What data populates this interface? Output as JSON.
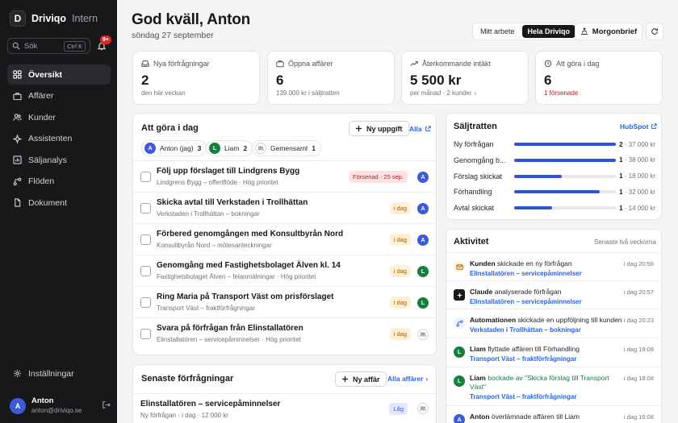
{
  "brand": {
    "name": "Driviqo",
    "sub": "Intern",
    "logo": "D"
  },
  "search": {
    "placeholder": "Sök",
    "shortcut": "Ctrl K"
  },
  "notifications": {
    "badge": "9+"
  },
  "nav": [
    {
      "label": "Översikt",
      "icon": "grid-icon",
      "active": true
    },
    {
      "label": "Affärer",
      "icon": "briefcase-icon"
    },
    {
      "label": "Kunder",
      "icon": "users-icon"
    },
    {
      "label": "Assistenten",
      "icon": "sparkle-icon"
    },
    {
      "label": "Säljanalys",
      "icon": "chart-icon"
    },
    {
      "label": "Flöden",
      "icon": "flow-icon"
    },
    {
      "label": "Dokument",
      "icon": "document-icon"
    }
  ],
  "settings": {
    "label": "Inställningar"
  },
  "user": {
    "initial": "A",
    "name": "Anton",
    "email": "anton@driviqo.se"
  },
  "header": {
    "greeting": "God kväll, Anton",
    "date": "söndag 27 september"
  },
  "view_toggle": {
    "options": [
      "Mitt arbete",
      "Hela Driviqo"
    ],
    "selected": "Hela Driviqo"
  },
  "morgonbrief": {
    "label": "Morgonbrief"
  },
  "stats": [
    {
      "label": "Nya förfrågningar",
      "value": "2",
      "sub": "den här veckan",
      "icon": "inbox-icon"
    },
    {
      "label": "Öppna affärer",
      "value": "6",
      "sub": "139 000 kr i säljtratten",
      "icon": "briefcase-icon"
    },
    {
      "label": "Återkommande intäkt",
      "value": "5 500 kr",
      "sub": "per månad · 2 kunder",
      "icon": "trend-icon"
    },
    {
      "label": "Att göra i dag",
      "value": "6",
      "sub": "1 försenade",
      "icon": "clock-icon"
    }
  ],
  "todo": {
    "title": "Att göra i dag",
    "new_task": "Ny uppgift",
    "all": "Alla",
    "chips": [
      {
        "initial": "A",
        "label": "Anton (jag)",
        "count": "3"
      },
      {
        "initial": "L",
        "label": "Liam",
        "count": "2"
      },
      {
        "label": "Gemensamt",
        "count": "1"
      }
    ],
    "tasks": [
      {
        "title": "Följ upp förslaget till Lindgrens Bygg",
        "sub": "Lindgrens Bygg – offertflöde · Hög prioritet",
        "badge": "Försenad · 25 sep.",
        "assignee": "A"
      },
      {
        "title": "Skicka avtal till Verkstaden i Trollhättan",
        "sub": "Verkstaden i Trollhättan – bokningar",
        "badge": "i dag",
        "assignee": "A"
      },
      {
        "title": "Förbered genomgången med Konsultbyrån Nord",
        "sub": "Konsultbyrån Nord – mötesanteckningar",
        "badge": "i dag",
        "assignee": "A"
      },
      {
        "title": "Genomgång med Fastighetsbolaget Älven kl. 14",
        "sub": "Fastighetsbolaget Älven – felanmälningar · Hög prioritet",
        "badge": "i dag",
        "assignee": "L"
      },
      {
        "title": "Ring Maria på Transport Väst om prisförslaget",
        "sub": "Transport Väst – fraktförfrågningar",
        "badge": "i dag",
        "assignee": "L"
      },
      {
        "title": "Svara på förfrågan från Elinstallatören",
        "sub": "Elinstallatören – servicepåminnelser · Hög prioritet",
        "badge": "i dag",
        "assignee": ""
      }
    ]
  },
  "requests": {
    "title": "Senaste förfrågningar",
    "new_deal": "Ny affär",
    "all": "Alla affärer",
    "items": [
      {
        "title": "Elinstallatören – servicepåminnelser",
        "sub": "Ny förfrågan · i dag · 12 000 kr",
        "badge": "Låg"
      }
    ]
  },
  "funnel": {
    "title": "Säljtratten",
    "link": "HubSpot",
    "stages": [
      {
        "label": "Ny förfrågan",
        "count": "2",
        "amount": "37 000 kr",
        "fill": 1.0
      },
      {
        "label": "Genomgång b...",
        "count": "1",
        "amount": "38 000 kr",
        "fill": 1.0
      },
      {
        "label": "Förslag skickat",
        "count": "1",
        "amount": "18 000 kr",
        "fill": 0.47
      },
      {
        "label": "Förhandling",
        "count": "1",
        "amount": "32 000 kr",
        "fill": 0.84
      },
      {
        "label": "Avtal skickat",
        "count": "1",
        "amount": "14 000 kr",
        "fill": 0.37
      }
    ]
  },
  "activity": {
    "title": "Aktivitet",
    "range": "Senaste två veckorna",
    "items": [
      {
        "actor": "Kunden",
        "text": "skickade en ny förfrågan",
        "link": "Elinstallatören – servicepåminnelser",
        "time": "i dag 20:56"
      },
      {
        "actor": "Claude",
        "text": "analyserade förfrågan",
        "link": "Elinstallatören – servicepåminnelser",
        "time": "i dag 20:57"
      },
      {
        "actor": "Automationen",
        "text": "skickade en uppföljning till kunden",
        "link": "Verkstaden i Trollhättan – bokningar",
        "time": "i dag 20:23"
      },
      {
        "actor": "Liam",
        "text": "flyttade affären till Förhandling",
        "link": "Transport Väst – fraktförfrågningar",
        "time": "i dag 19:08"
      },
      {
        "actor": "Liam",
        "text": "bockade av \"Skicka förslag till Transport Väst\"",
        "link": "Transport Väst – fraktförfrågningar",
        "time": "i dag 18:08"
      },
      {
        "actor": "Anton",
        "text": "överlämnade affären till Liam",
        "link": "",
        "time": "i dag 16:08"
      }
    ]
  },
  "colors": {
    "accent": "#2f55d4",
    "sidebar": "#18181b",
    "overdue": "#b91c1c",
    "today": "#a15c07"
  }
}
